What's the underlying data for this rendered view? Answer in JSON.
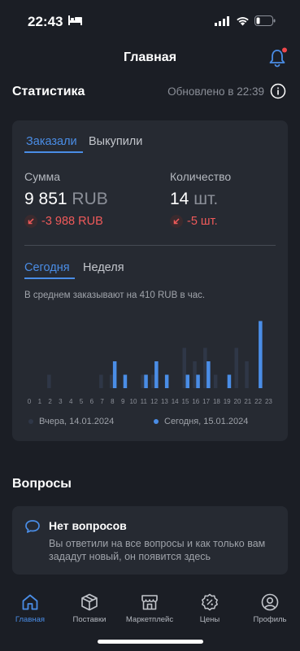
{
  "status_bar": {
    "time": "22:43"
  },
  "header": {
    "title": "Главная"
  },
  "stats": {
    "title": "Статистика",
    "updated": "Обновлено в 22:39",
    "tabs": [
      "Заказали",
      "Выкупили"
    ],
    "sum": {
      "label": "Сумма",
      "value": "9 851",
      "unit": "RUB",
      "delta": "-3 988 RUB"
    },
    "quantity": {
      "label": "Количество",
      "value": "14",
      "unit": "шт.",
      "delta": "-5 шт."
    },
    "period_tabs": [
      "Сегодня",
      "Неделя"
    ],
    "hint": "В среднем заказывают на 410 RUB в час."
  },
  "chart_data": {
    "type": "bar",
    "categories": [
      "0",
      "1",
      "2",
      "3",
      "4",
      "5",
      "6",
      "7",
      "8",
      "9",
      "10",
      "11",
      "12",
      "13",
      "14",
      "15",
      "16",
      "17",
      "18",
      "19",
      "20",
      "21",
      "22",
      "23"
    ],
    "series": [
      {
        "name": "Вчера, 14.01.2024",
        "color": "#2f3747",
        "values": [
          0,
          0,
          1,
          0,
          0,
          0,
          0,
          1,
          1,
          0,
          0,
          1,
          1,
          0,
          0,
          3,
          2,
          3,
          1,
          0,
          3,
          2,
          0,
          0
        ]
      },
      {
        "name": "Сегодня, 15.01.2024",
        "color": "#4a8de6",
        "values": [
          0,
          0,
          0,
          0,
          0,
          0,
          0,
          0,
          2,
          1,
          0,
          1,
          2,
          1,
          0,
          1,
          1,
          2,
          0,
          1,
          0,
          0,
          5,
          0
        ]
      }
    ],
    "legend": [
      "Вчера, 14.01.2024",
      "Сегодня, 15.01.2024"
    ],
    "legend_position": "bottom",
    "grid": false
  },
  "questions": {
    "title": "Вопросы",
    "empty_title": "Нет вопросов",
    "empty_text": "Вы ответили на все вопросы и как только вам зададут новый, он появится здесь"
  },
  "tabbar": {
    "items": [
      {
        "label": "Главная",
        "icon": "home-icon"
      },
      {
        "label": "Поставки",
        "icon": "box-icon"
      },
      {
        "label": "Маркетплейс",
        "icon": "store-icon"
      },
      {
        "label": "Цены",
        "icon": "percent-badge-icon"
      },
      {
        "label": "Профиль",
        "icon": "profile-icon"
      }
    ]
  }
}
